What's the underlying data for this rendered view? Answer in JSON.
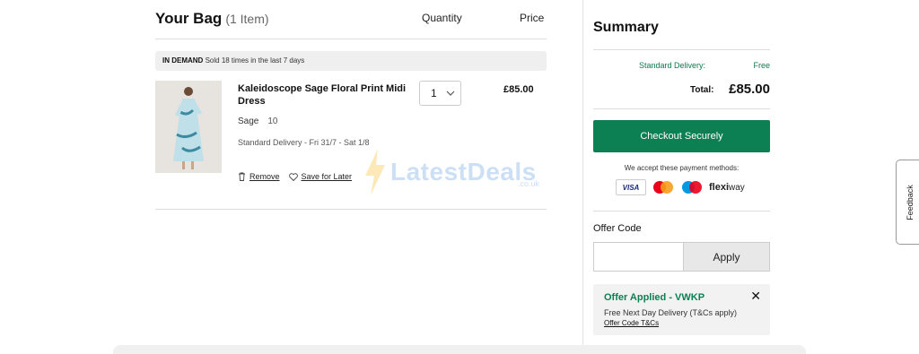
{
  "bag": {
    "title": "Your Bag",
    "count": "(1 Item)",
    "col_quantity": "Quantity",
    "col_price": "Price",
    "demand_tag": "IN DEMAND",
    "demand_text": "Sold 18 times in the last 7 days"
  },
  "item": {
    "name": "Kaleidoscope Sage Floral Print Midi Dress",
    "attr_label": "Sage",
    "size": "10",
    "delivery": "Standard Delivery - Fri 31/7 - Sat 1/8",
    "quantity": "1",
    "price": "£85.00",
    "remove_label": "Remove",
    "save_label": "Save for Later"
  },
  "watermark": {
    "text": "LatestDeals",
    "sub": ".co.uk"
  },
  "summary": {
    "title": "Summary",
    "standard_delivery_label": "Standard Delivery:",
    "standard_delivery_value": "Free",
    "total_label": "Total:",
    "total_value": "£85.00",
    "checkout_label": "Checkout Securely",
    "accept_text": "We accept these payment methods:",
    "payment_methods": [
      "VISA",
      "mastercard-icon",
      "maestro-icon",
      "flexiway"
    ],
    "flexi_a": "flexi",
    "flexi_b": "way",
    "offer_code_label": "Offer Code",
    "offer_input_value": "",
    "apply_label": "Apply",
    "offer_title": "Offer Applied - VWKP",
    "offer_desc": "Free Next Day Delivery (T&Cs apply)",
    "offer_link": "Offer Code T&Cs"
  },
  "feedback_label": "Feedback",
  "colors": {
    "accent_green": "#0c7f53",
    "delivery_green": "#0c7a4c"
  }
}
